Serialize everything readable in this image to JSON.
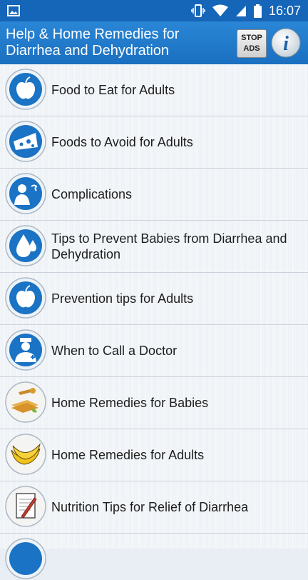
{
  "status": {
    "time": "16:07",
    "icons": [
      "gallery-icon",
      "vibrate-icon",
      "wifi-icon",
      "signal-icon",
      "battery-icon"
    ]
  },
  "appbar": {
    "title": "Help & Home Remedies for Diarrhea and Dehydration",
    "stop_ads_line1": "STOP",
    "stop_ads_line2": "ADS",
    "info_glyph": "i"
  },
  "list": {
    "items": [
      {
        "label": "Food to Eat for Adults",
        "icon": "apple-icon"
      },
      {
        "label": "Foods to Avoid for Adults",
        "icon": "cheese-icon"
      },
      {
        "label": "Complications",
        "icon": "sick-person-icon"
      },
      {
        "label": "Tips to Prevent Babies from Diarrhea and Dehydration",
        "icon": "water-drops-icon"
      },
      {
        "label": "Prevention tips for Adults",
        "icon": "apple-icon"
      },
      {
        "label": "When to Call a Doctor",
        "icon": "doctor-icon"
      },
      {
        "label": "Home Remedies for Babies",
        "icon": "honey-toast-icon"
      },
      {
        "label": "Home Remedies for Adults",
        "icon": "banana-icon"
      },
      {
        "label": "Nutrition Tips for Relief of Diarrhea",
        "icon": "notepad-icon"
      }
    ]
  },
  "colors": {
    "statusbar": "#1565b8",
    "appbar": "#1f77c9",
    "icon_blue": "#1a73c4",
    "row_divider": "#c9d2db"
  }
}
